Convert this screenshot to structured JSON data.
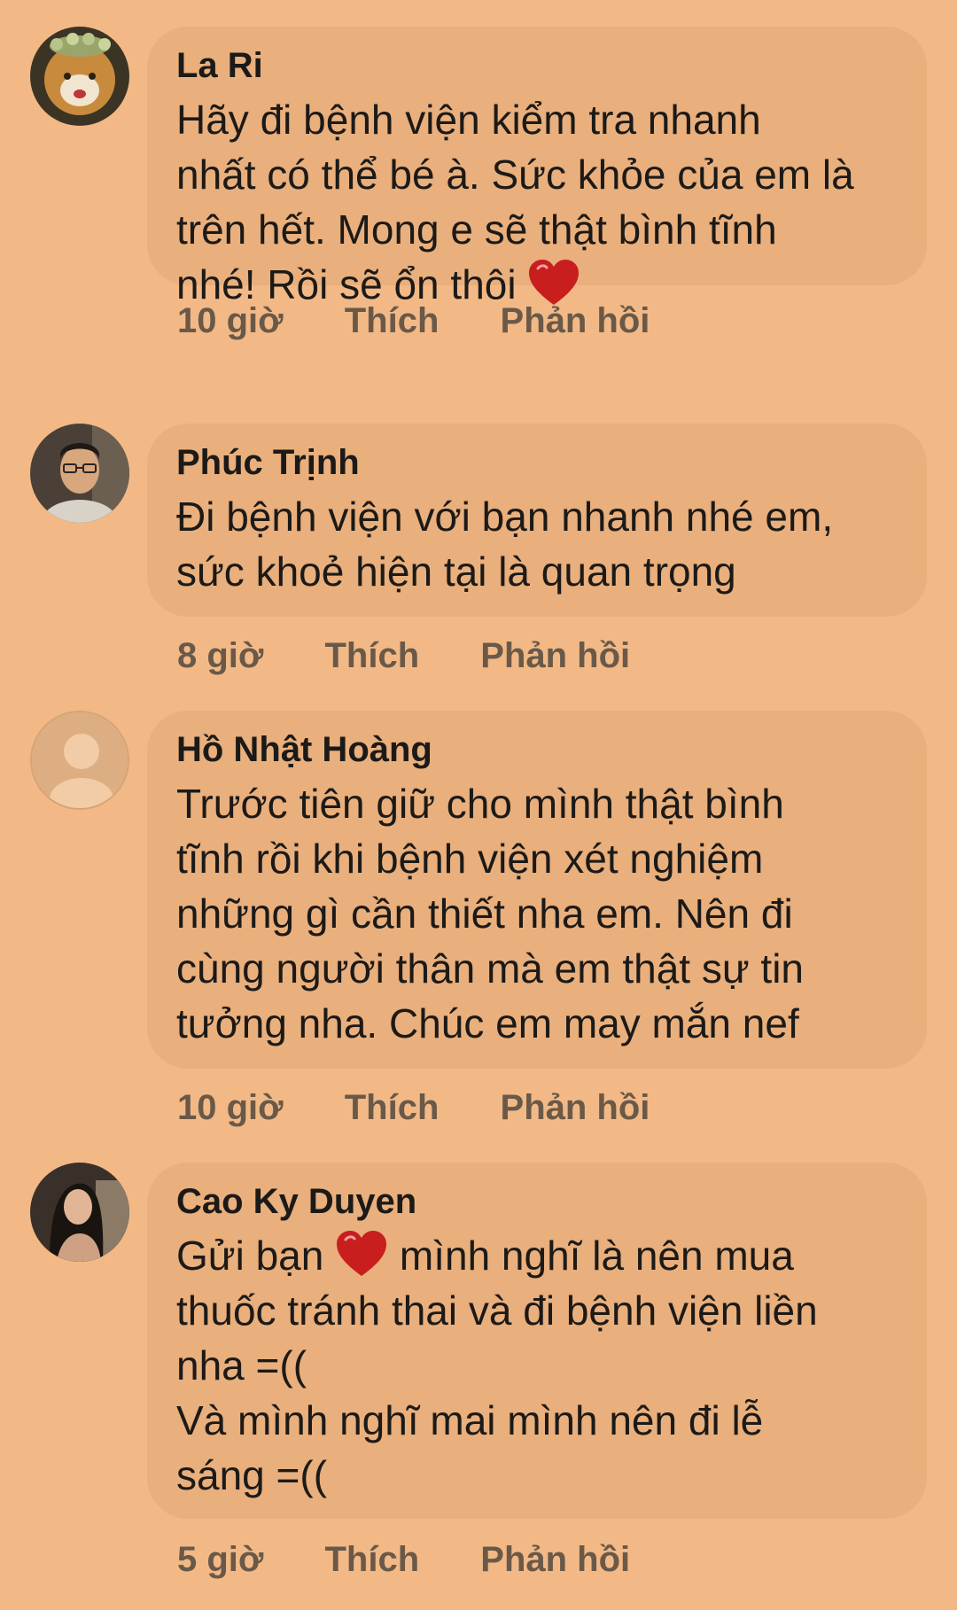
{
  "comments": [
    {
      "author": "La Ri",
      "lines": [
        "Hãy đi bệnh viện kiểm tra nhanh",
        "nhất có thể bé à. Sức khỏe của em là",
        "trên hết. Mong e sẽ thật bình tĩnh",
        "nhé! Rồi sẽ ổn thôi"
      ],
      "time": "10 giờ",
      "like": "Thích",
      "reply": "Phản hồi"
    },
    {
      "author": "Phúc Trịnh",
      "lines": [
        "Đi bệnh viện với bạn nhanh nhé em,",
        "sức khoẻ hiện tại là quan trọng"
      ],
      "time": "8 giờ",
      "like": "Thích",
      "reply": "Phản hồi"
    },
    {
      "author": "Hồ Nhật Hoàng",
      "lines": [
        "Trước tiên giữ cho mình thật bình",
        "tĩnh rồi khi bệnh viện xét nghiệm",
        "những gì cần thiết nha em. Nên đi",
        "cùng người thân mà em thật sự tin",
        "tưởng nha. Chúc em may mắn nef"
      ],
      "time": "10 giờ",
      "like": "Thích",
      "reply": "Phản hồi"
    },
    {
      "author": "Cao Ky Duyen",
      "lines": [
        "Gửi bạn",
        "mình nghĩ là nên mua",
        "thuốc tránh thai và đi bệnh viện liền",
        "nha =((",
        "Và mình nghĩ mai mình nên đi lễ",
        "sáng =(("
      ],
      "time": "5 giờ",
      "like": "Thích",
      "reply": "Phản hồi"
    }
  ],
  "icons": {
    "heart": "heart-emoji",
    "avatar_placeholder": "default-avatar-icon"
  },
  "colors": {
    "background": "#F2B986",
    "bubble": "#E9AF7C",
    "text": "#1c1a18",
    "meta": "#6a5948",
    "heart": "#C81E1E"
  }
}
